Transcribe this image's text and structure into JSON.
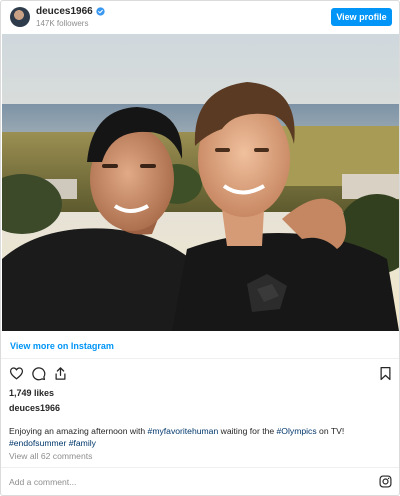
{
  "header": {
    "username": "deuces1966",
    "followers": "147K followers",
    "view_profile_label": "View profile"
  },
  "post": {
    "view_more_label": "View more on Instagram",
    "likes": "1,749 likes",
    "owner": "deuces1966",
    "caption_text": "Enjoying an amazing afternoon with ",
    "tag1": "#myfavoritehuman",
    "caption_mid": " waiting for the ",
    "tag2": "#Olympics",
    "caption_end": " on TV!",
    "tag3": "#endofsummer",
    "tag4": "#family",
    "view_all_comments": "View all 62 comments",
    "add_comment_placeholder": "Add a comment..."
  },
  "icons": {
    "verified": "verified-badge-icon",
    "like": "heart-icon",
    "comment": "comment-icon",
    "share": "share-icon",
    "save": "bookmark-icon",
    "instagram": "instagram-logo-icon"
  },
  "colors": {
    "accent": "#0095f6",
    "hashtag": "#00376b",
    "muted": "#8e8e8e"
  }
}
